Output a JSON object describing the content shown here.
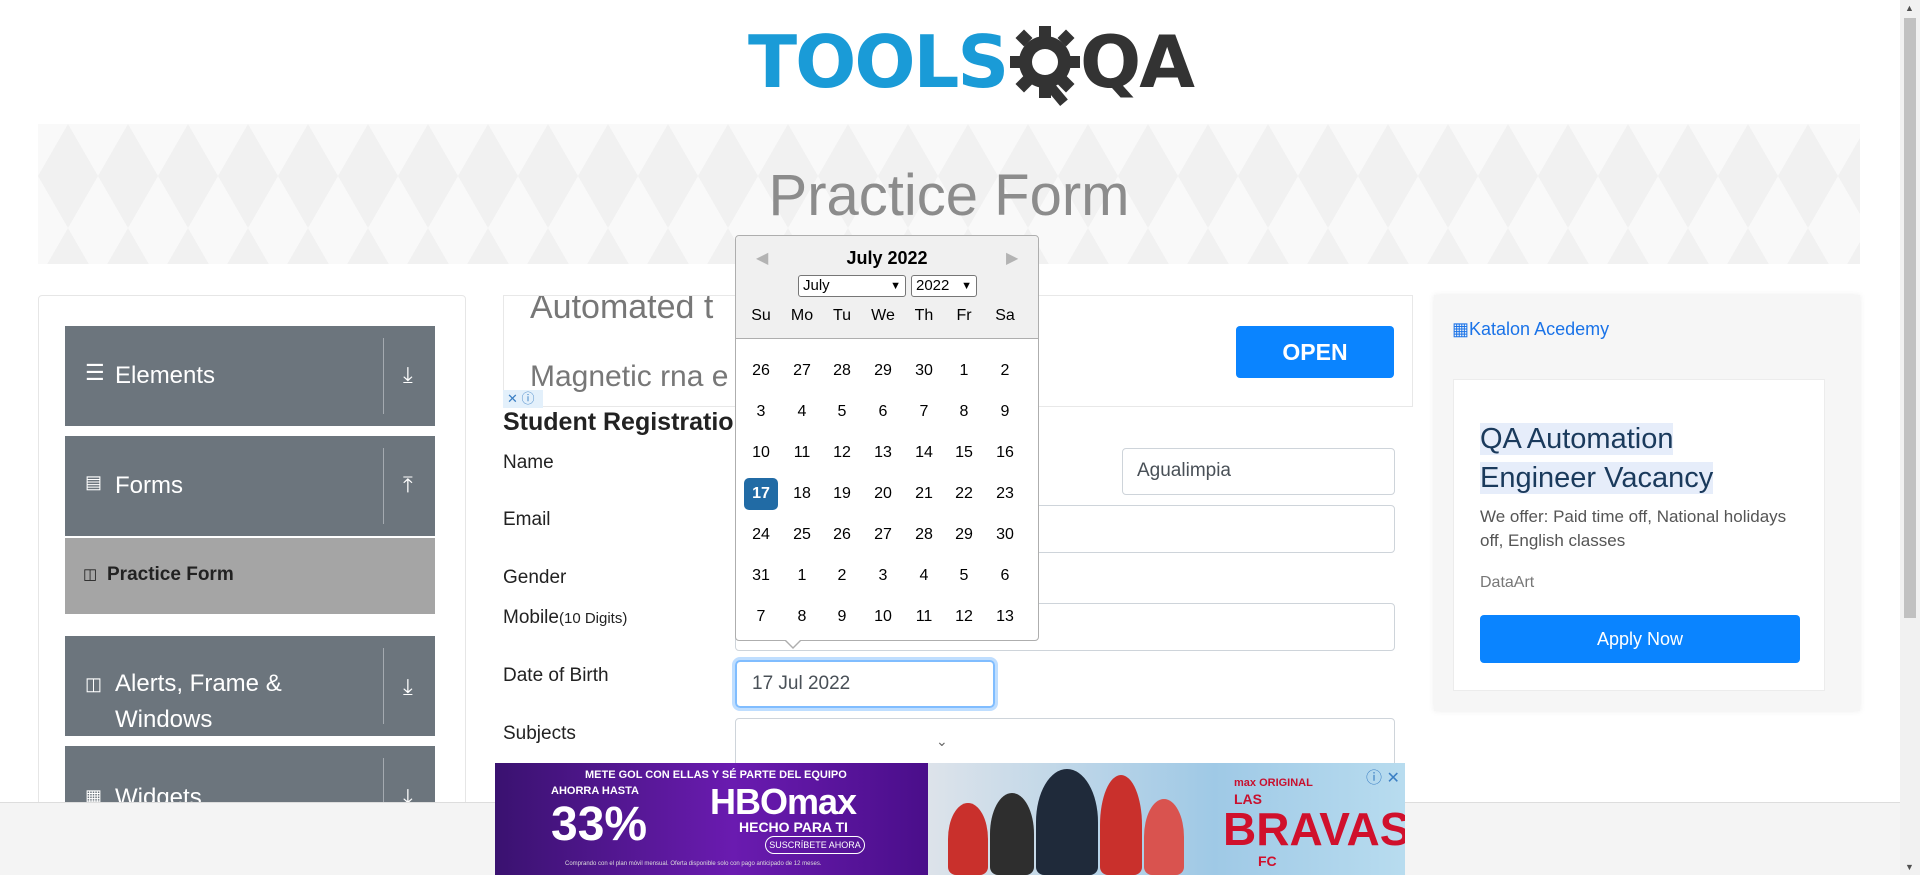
{
  "header": {
    "logo_text": "TOOLS",
    "logo_qa": "QA",
    "page_title": "Practice Form"
  },
  "sidebar": {
    "groups": [
      {
        "label": "Elements",
        "icon": "hamburger-icon",
        "arrow": "download-icon"
      },
      {
        "label": "Forms",
        "icon": "document-icon",
        "arrow": "upload-icon"
      },
      {
        "label": "Alerts, Frame &",
        "label2": "Windows",
        "icon": "window-icon",
        "arrow": "download-icon"
      },
      {
        "label": "Widgets",
        "icon": "widgets-icon",
        "arrow": "download-icon"
      }
    ],
    "active_item": "Practice Form"
  },
  "ad_top": {
    "line1": "Automated t",
    "line2": "Magnetic rna e",
    "button": "OPEN"
  },
  "form": {
    "heading": "Student Registration",
    "name_label": "Name",
    "last_name_value": "Agualimpia",
    "email_label": "Email",
    "gender_label": "Gender",
    "mobile_label": "Mobile",
    "mobile_hint": "(10 Digits)",
    "dob_label": "Date of Birth",
    "dob_value": "17 Jul 2022",
    "subjects_label": "Subjects"
  },
  "datepicker": {
    "title": "July 2022",
    "month_select": "July",
    "year_select": "2022",
    "day_names": [
      "Su",
      "Mo",
      "Tu",
      "We",
      "Th",
      "Fr",
      "Sa"
    ],
    "weeks": [
      [
        "26",
        "27",
        "28",
        "29",
        "30",
        "1",
        "2"
      ],
      [
        "3",
        "4",
        "5",
        "6",
        "7",
        "8",
        "9"
      ],
      [
        "10",
        "11",
        "12",
        "13",
        "14",
        "15",
        "16"
      ],
      [
        "17",
        "18",
        "19",
        "20",
        "21",
        "22",
        "23"
      ],
      [
        "24",
        "25",
        "26",
        "27",
        "28",
        "29",
        "30"
      ],
      [
        "31",
        "1",
        "2",
        "3",
        "4",
        "5",
        "6"
      ],
      [
        "7",
        "8",
        "9",
        "10",
        "11",
        "12",
        "13"
      ]
    ],
    "selected": "17"
  },
  "ad_right": {
    "image_alt": "Katalon Acedemy",
    "title_line1": "QA Automation",
    "title_line2": "Engineer Vacancy",
    "body": "We offer: Paid time off, National holidays off, English classes",
    "company": "DataArt",
    "button": "Apply Now"
  },
  "ad_bottom": {
    "tagline": "METE GOL CON ELLAS Y SÉ PARTE DEL EQUIPO",
    "promo": "AHORRA HASTA",
    "percent": "33%",
    "brand": "HBOmax",
    "brand_sub": "HECHO PARA TI",
    "cta": "SUSCRÍBETE AHORA",
    "show_badge": "max ORIGINAL",
    "show_pre": "LAS",
    "show_title": "BRAVAS",
    "show_suffix": "FC",
    "fine_print": "Comprando con el plan móvil mensual. Oferta disponible solo con pago anticipado de 12 meses."
  },
  "colors": {
    "accent": "#216ba5",
    "button_blue": "#0a84ff",
    "sidebar_bg": "#6c757d",
    "active_item_bg": "#a5a5a5"
  }
}
